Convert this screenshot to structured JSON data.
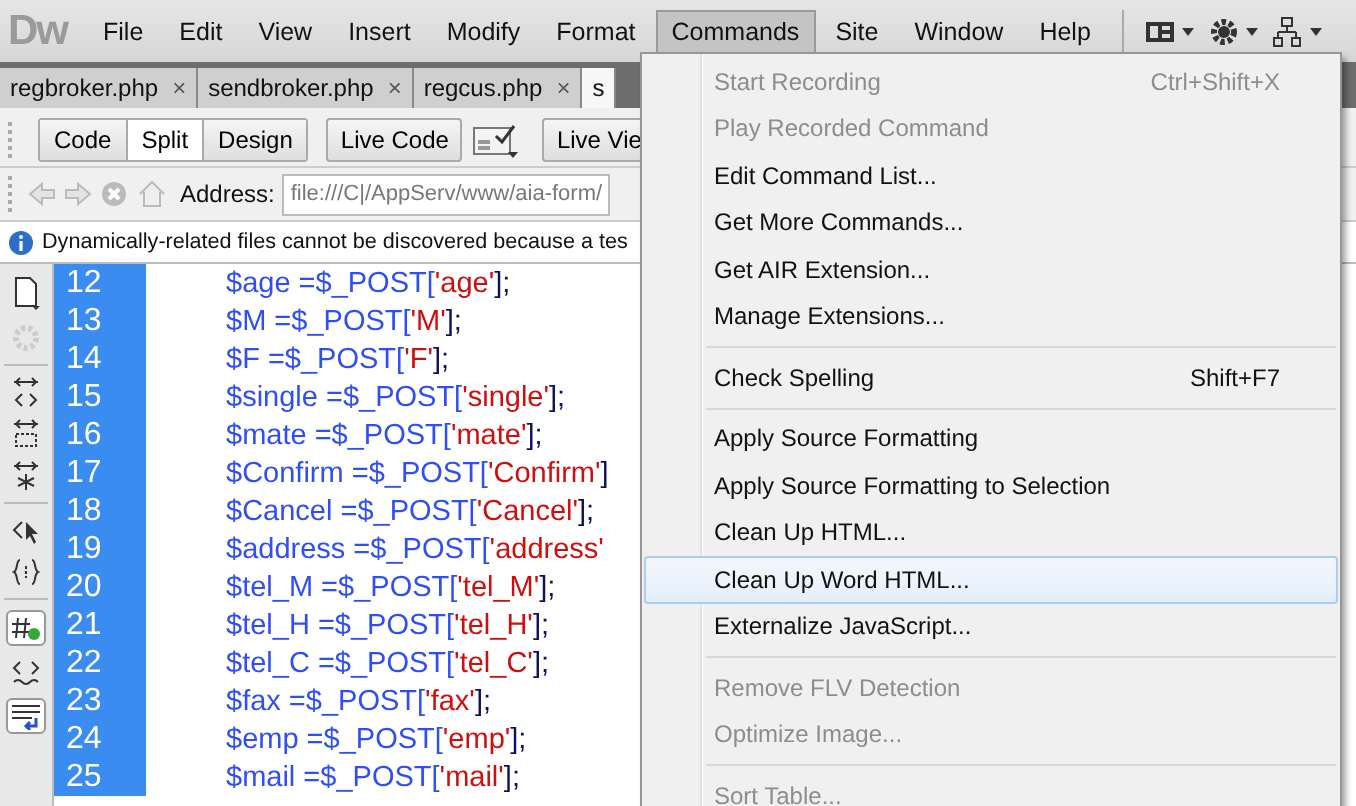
{
  "app": {
    "logo": "Dw"
  },
  "menu_bar": [
    {
      "label": "File",
      "selected": false
    },
    {
      "label": "Edit",
      "selected": false
    },
    {
      "label": "View",
      "selected": false
    },
    {
      "label": "Insert",
      "selected": false
    },
    {
      "label": "Modify",
      "selected": false
    },
    {
      "label": "Format",
      "selected": false
    },
    {
      "label": "Commands",
      "selected": true
    },
    {
      "label": "Site",
      "selected": false
    },
    {
      "label": "Window",
      "selected": false
    },
    {
      "label": "Help",
      "selected": false
    }
  ],
  "document_tabs": [
    {
      "label": "regbroker.php",
      "close": "×",
      "selected": false
    },
    {
      "label": "sendbroker.php",
      "close": "×",
      "selected": false
    },
    {
      "label": "regcus.php",
      "close": "×",
      "selected": false
    },
    {
      "label": "s",
      "selected": true
    }
  ],
  "view_buttons": [
    {
      "label": "Code",
      "selected": false
    },
    {
      "label": "Split",
      "selected": true
    },
    {
      "label": "Design",
      "selected": false
    }
  ],
  "live_code": "Live Code",
  "live_view": "Live Vie",
  "address": {
    "label": "Address:",
    "value": "file:///C|/AppServ/www/aia-form/"
  },
  "info_bar": "Dynamically-related files cannot be discovered because a tes",
  "code_lines": [
    {
      "number": "12",
      "lhs": "$age =$_POST[",
      "key": "'age'",
      "end": "];"
    },
    {
      "number": "13",
      "lhs": "$M =$_POST[",
      "key": "'M'",
      "end": "];"
    },
    {
      "number": "14",
      "lhs": "$F =$_POST[",
      "key": "'F'",
      "end": "];"
    },
    {
      "number": "15",
      "lhs": "$single =$_POST[",
      "key": "'single'",
      "end": "];"
    },
    {
      "number": "16",
      "lhs": "$mate =$_POST[",
      "key": "'mate'",
      "end": "];"
    },
    {
      "number": "17",
      "lhs": "$Confirm =$_POST[",
      "key": "'Confirm'",
      "end": "]"
    },
    {
      "number": "18",
      "lhs": "$Cancel =$_POST[",
      "key": "'Cancel'",
      "end": "];"
    },
    {
      "number": "19",
      "lhs": "$address =$_POST[",
      "key": "'address'"
    },
    {
      "number": "20",
      "lhs": "$tel_M =$_POST[",
      "key": "'tel_M'",
      "end": "];"
    },
    {
      "number": "21",
      "lhs": "$tel_H =$_POST[",
      "key": "'tel_H'",
      "end": "];"
    },
    {
      "number": "22",
      "lhs": "$tel_C =$_POST[",
      "key": "'tel_C'",
      "end": "];"
    },
    {
      "number": "23",
      "lhs": "$fax =$_POST[",
      "key": "'fax'",
      "end": "];"
    },
    {
      "number": "24",
      "lhs": "$emp =$_POST[",
      "key": "'emp'",
      "end": "];"
    },
    {
      "number": "25",
      "lhs": "$mail =$_POST[",
      "key": "'mail'",
      "end": "];"
    }
  ],
  "commands_menu": [
    {
      "kind": "item",
      "label": "Start Recording",
      "shortcut": "Ctrl+Shift+X",
      "disabled": true,
      "selected": false
    },
    {
      "kind": "item",
      "label": "Play Recorded Command",
      "disabled": true,
      "selected": false
    },
    {
      "kind": "item",
      "label": "Edit Command List...",
      "disabled": false,
      "selected": false
    },
    {
      "kind": "item",
      "label": "Get More Commands...",
      "disabled": false,
      "selected": false
    },
    {
      "kind": "item",
      "label": "Get AIR Extension...",
      "disabled": false,
      "selected": false
    },
    {
      "kind": "item",
      "label": "Manage Extensions...",
      "disabled": false,
      "selected": false
    },
    {
      "kind": "separator"
    },
    {
      "kind": "item",
      "label": "Check Spelling",
      "shortcut": "Shift+F7",
      "disabled": false,
      "selected": false
    },
    {
      "kind": "separator"
    },
    {
      "kind": "item",
      "label": "Apply Source Formatting",
      "disabled": false,
      "selected": false
    },
    {
      "kind": "item",
      "label": "Apply Source Formatting to Selection",
      "disabled": false,
      "selected": false
    },
    {
      "kind": "item",
      "label": "Clean Up HTML...",
      "disabled": false,
      "selected": false
    },
    {
      "kind": "item",
      "label": "Clean Up Word HTML...",
      "disabled": false,
      "selected": true
    },
    {
      "kind": "item",
      "label": "Externalize JavaScript...",
      "disabled": false,
      "selected": false
    },
    {
      "kind": "separator"
    },
    {
      "kind": "item",
      "label": "Remove FLV Detection",
      "disabled": true,
      "selected": false
    },
    {
      "kind": "item",
      "label": "Optimize Image...",
      "disabled": true,
      "selected": false
    },
    {
      "kind": "separator"
    },
    {
      "kind": "item",
      "label": "Sort Table...",
      "disabled": true,
      "selected": false
    }
  ]
}
